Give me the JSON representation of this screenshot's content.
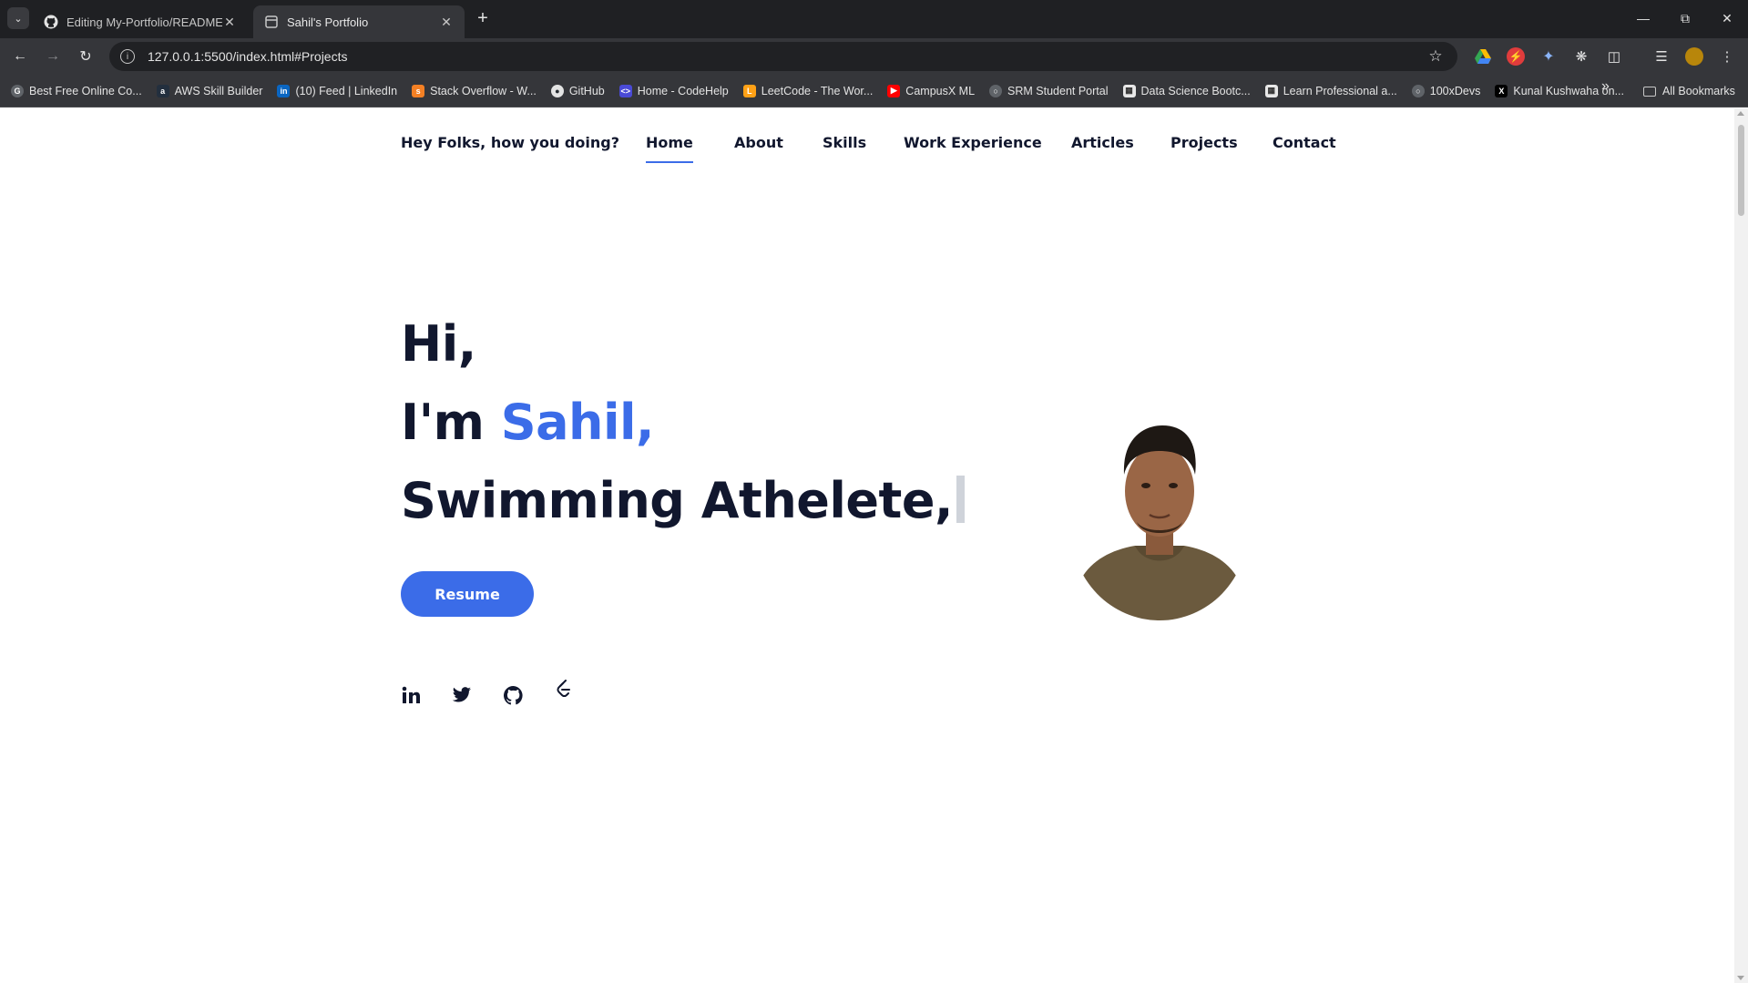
{
  "browser": {
    "tabs": [
      {
        "title": "Editing My-Portfolio/README.m",
        "favicon": "github-icon",
        "active": false
      },
      {
        "title": "Sahil's Portfolio",
        "favicon": "page-icon",
        "active": true
      }
    ],
    "url": "127.0.0.1:5500/index.html#Projects",
    "bookmarks": [
      {
        "label": "Best Free Online Co...",
        "icon": "g-icon",
        "color": "#5f6368"
      },
      {
        "label": "AWS Skill Builder",
        "icon": "aws-icon",
        "color": "#232f3e"
      },
      {
        "label": "(10) Feed | LinkedIn",
        "icon": "linkedin-icon",
        "color": "#0a66c2"
      },
      {
        "label": "Stack Overflow - W...",
        "icon": "stackoverflow-icon",
        "color": "#f48024"
      },
      {
        "label": "GitHub",
        "icon": "github-icon",
        "color": "#24292f"
      },
      {
        "label": "Home - CodeHelp",
        "icon": "codehelp-icon",
        "color": "#4a4ad6"
      },
      {
        "label": "LeetCode - The Wor...",
        "icon": "leetcode-icon",
        "color": "#ffa116"
      },
      {
        "label": "CampusX ML",
        "icon": "youtube-icon",
        "color": "#ff0000"
      },
      {
        "label": "SRM Student Portal",
        "icon": "globe-icon",
        "color": "#5f6368"
      },
      {
        "label": "Data Science Bootc...",
        "icon": "page-icon",
        "color": "#e8e8e8"
      },
      {
        "label": "Learn Professional a...",
        "icon": "page-icon",
        "color": "#e8e8e8"
      },
      {
        "label": "100xDevs",
        "icon": "globe-icon",
        "color": "#5f6368"
      },
      {
        "label": "Kunal Kushwaha on...",
        "icon": "x-icon",
        "color": "#000000"
      }
    ],
    "all_bookmarks": "All Bookmarks"
  },
  "site": {
    "greeting": "Hey Folks, how you doing?",
    "nav": [
      "Home",
      "About",
      "Skills",
      "Work Experience",
      "Articles",
      "Projects",
      "Contact"
    ],
    "active_nav": "Home",
    "hero": {
      "line1": "Hi,",
      "line2_prefix": "I'm ",
      "name": "Sahil,",
      "line3": "Swimming Athelete,"
    },
    "resume_label": "Resume",
    "socials": [
      "linkedin-icon",
      "twitter-icon",
      "github-icon",
      "leetcode-icon"
    ],
    "colors": {
      "accent": "#3b6ce8",
      "text": "#11172e"
    }
  }
}
